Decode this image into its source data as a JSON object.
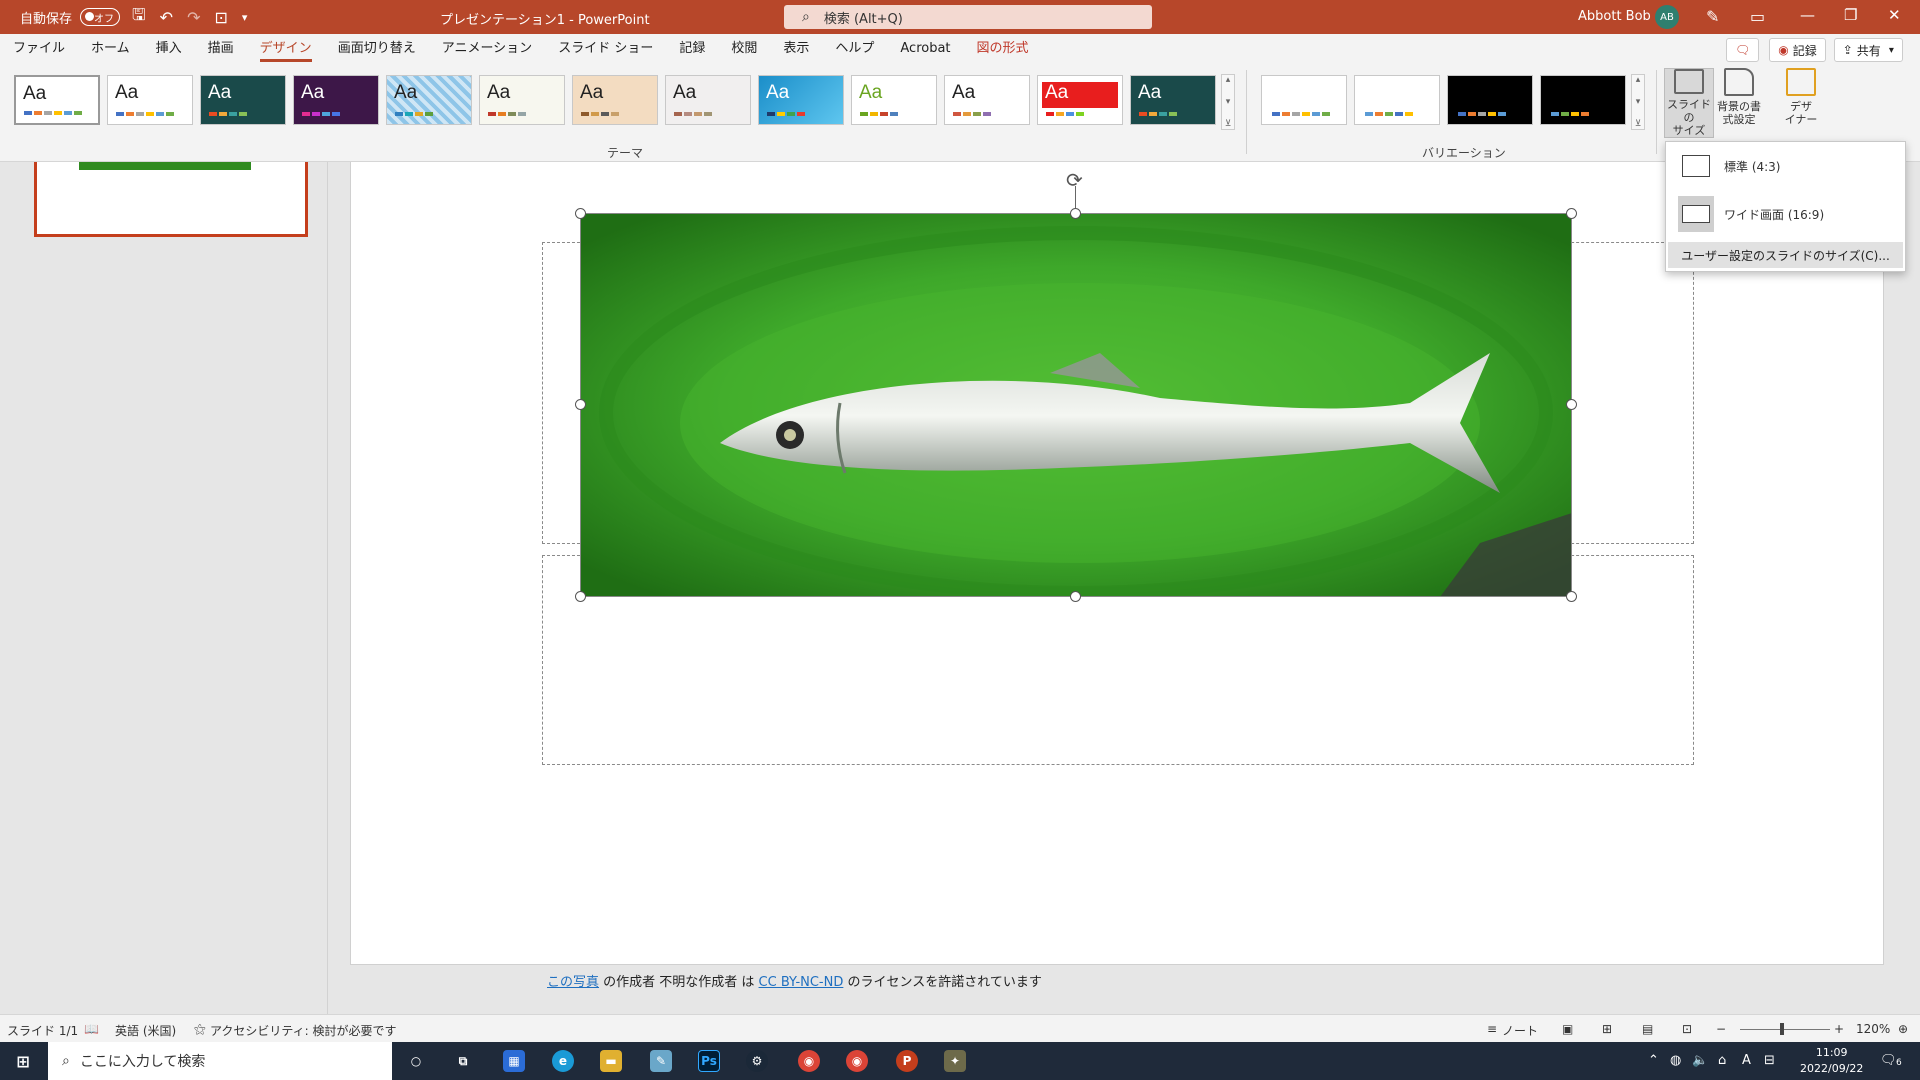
{
  "titlebar": {
    "autosave_label": "自動保存",
    "autosave_state": "オフ",
    "doc_title": "プレゼンテーション1 - PowerPoint",
    "search_placeholder": "検索 (Alt+Q)",
    "user_name": "Abbott Bob",
    "user_initials": "AB"
  },
  "menu": {
    "tabs": [
      "ファイル",
      "ホーム",
      "挿入",
      "描画",
      "デザイン",
      "画面切り替え",
      "アニメーション",
      "スライド ショー",
      "記録",
      "校閲",
      "表示",
      "ヘルプ",
      "Acrobat",
      "図の形式"
    ],
    "active_tab": "デザイン",
    "comments_label": "",
    "record_label": "記録",
    "share_label": "共有"
  },
  "ribbon": {
    "themes_label": "テーマ",
    "variations_label": "バリエーション",
    "theme_sample_text": "Aa",
    "slide_size_label": "スライドの\nサイズ",
    "format_bg_label": "背景の書\n式設定",
    "designer_label": "デザ\nイナー"
  },
  "slide_size_menu": {
    "standard": "標準 (4:3)",
    "widescreen": "ワイド画面 (16:9)",
    "custom": "ユーザー設定のスライドのサイズ(C)..."
  },
  "credit": {
    "link1": "この写真",
    "text1": " の作成者 不明な作成者 は ",
    "link2": "CC BY-NC-ND",
    "text2": " のライセンスを許諾されています"
  },
  "status": {
    "slide_count": "スライド 1/1",
    "language": "英語 (米国)",
    "accessibility": "アクセシビリティ: 検討が必要です",
    "notes": "ノート",
    "zoom": "120%"
  },
  "taskbar": {
    "search_placeholder": "ここに入力して検索",
    "time": "11:09",
    "date": "2022/09/22",
    "notification_count": "6",
    "ime_label": "A"
  },
  "colors": {
    "accent": "#b7472a",
    "link": "#1e6fc0",
    "photo_green": "#2d8a1c"
  }
}
